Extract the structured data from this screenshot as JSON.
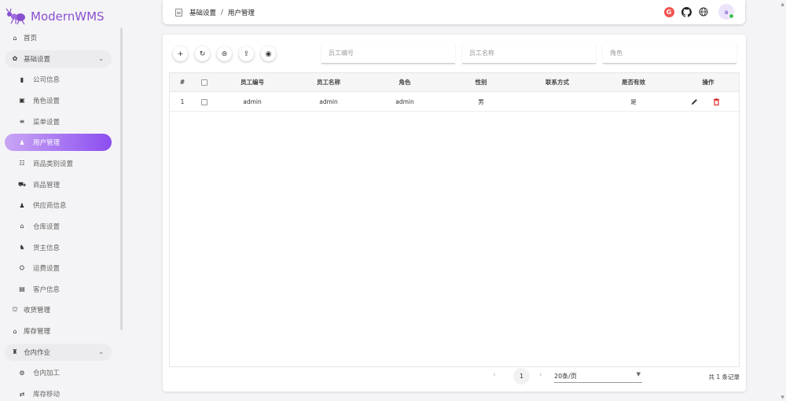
{
  "app": {
    "name": "ModernWMS",
    "brand_color": "#8a4fd0",
    "accent_gradient": [
      "#c9a6f4",
      "#8c4ef0"
    ]
  },
  "sidebar": {
    "items": [
      {
        "label": "首页",
        "icon": "home-icon",
        "glyph": "⌂",
        "level": "top"
      },
      {
        "label": "基础设置",
        "icon": "gear-icon",
        "glyph": "✿",
        "level": "top",
        "expanded": true
      },
      {
        "label": "公司信息",
        "icon": "building-icon",
        "glyph": "▮",
        "level": "sub"
      },
      {
        "label": "角色设置",
        "icon": "role-icon",
        "glyph": "▣",
        "level": "sub"
      },
      {
        "label": "菜单设置",
        "icon": "menu-icon",
        "glyph": "≡",
        "level": "sub"
      },
      {
        "label": "用户管理",
        "icon": "user-icon",
        "glyph": "♟",
        "level": "sub",
        "active": true
      },
      {
        "label": "商品类别设置",
        "icon": "list-icon",
        "glyph": "☷",
        "level": "sub"
      },
      {
        "label": "商品管理",
        "icon": "cart-icon",
        "glyph": "⛟",
        "level": "sub"
      },
      {
        "label": "供应商信息",
        "icon": "supplier-icon",
        "glyph": "♟",
        "level": "sub"
      },
      {
        "label": "仓库设置",
        "icon": "warehouse-icon",
        "glyph": "⌂",
        "level": "sub"
      },
      {
        "label": "货主信息",
        "icon": "owner-icon",
        "glyph": "♞",
        "level": "sub"
      },
      {
        "label": "运费设置",
        "icon": "freight-icon",
        "glyph": "⛭",
        "level": "sub"
      },
      {
        "label": "客户信息",
        "icon": "customer-icon",
        "glyph": "▤",
        "level": "sub"
      },
      {
        "label": "收货管理",
        "icon": "receive-icon",
        "glyph": "⛫",
        "level": "top"
      },
      {
        "label": "库存管理",
        "icon": "stock-icon",
        "glyph": "⌂",
        "level": "top"
      },
      {
        "label": "仓内作业",
        "icon": "operation-icon",
        "glyph": "♜",
        "level": "top",
        "expanded": true
      },
      {
        "label": "仓内加工",
        "icon": "process-icon",
        "glyph": "⚙",
        "level": "sub"
      },
      {
        "label": "库存移动",
        "icon": "move-icon",
        "glyph": "⇄",
        "level": "sub"
      }
    ]
  },
  "header": {
    "breadcrumb": [
      "基础设置",
      "用户管理"
    ],
    "avatar_letter": "a",
    "icons": [
      "google-icon",
      "github-icon",
      "globe-icon"
    ]
  },
  "toolbar": {
    "buttons": [
      {
        "name": "add-button",
        "glyph": "+"
      },
      {
        "name": "refresh-button",
        "glyph": "↻"
      },
      {
        "name": "import-button",
        "glyph": "⊜"
      },
      {
        "name": "export-button",
        "glyph": "⇪"
      },
      {
        "name": "view-button",
        "glyph": "◉"
      }
    ],
    "search_placeholders": {
      "user_num": "员工编号",
      "user_name": "员工名称",
      "user_role": "角色"
    }
  },
  "table": {
    "columns": [
      "#",
      "",
      "员工编号",
      "员工名称",
      "角色",
      "性别",
      "联系方式",
      "是否有效",
      "操作"
    ],
    "rows": [
      {
        "index": "1",
        "user_num": "admin",
        "user_name": "admin",
        "user_role": "admin",
        "sex": "男",
        "contact": "",
        "is_valid": "是"
      }
    ]
  },
  "pager": {
    "current_page": "1",
    "page_size": "20条/页",
    "total": "共 1 条记录"
  }
}
